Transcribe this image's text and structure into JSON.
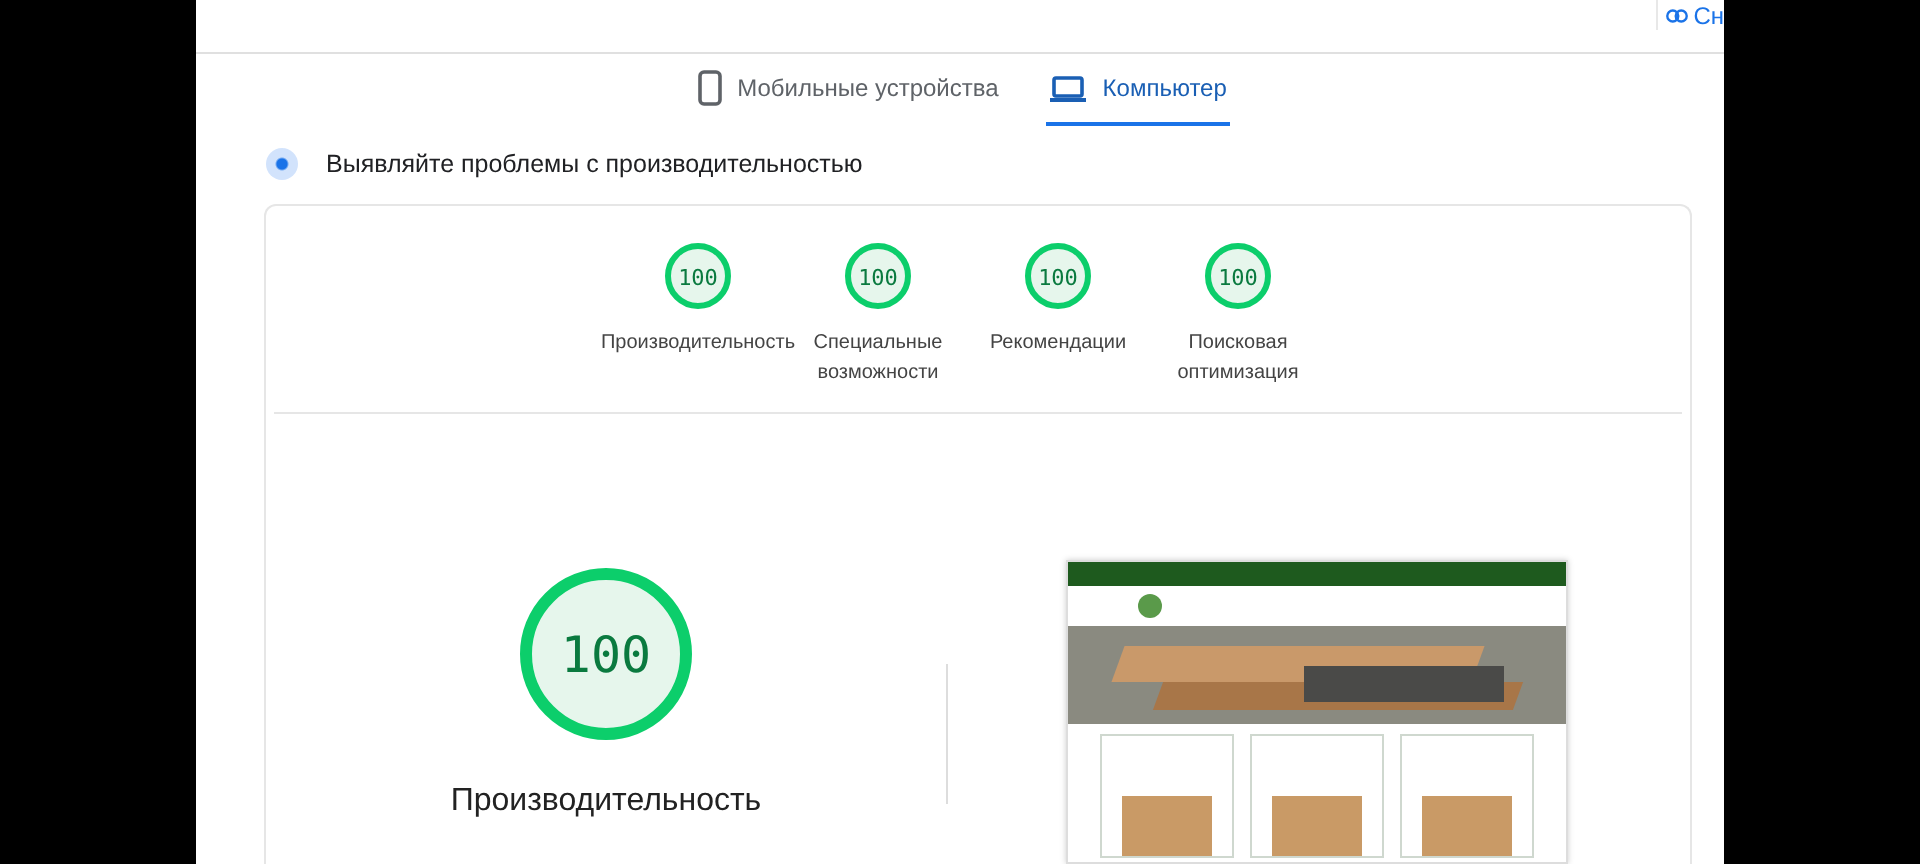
{
  "top_link": {
    "label": "Сн"
  },
  "tabs": [
    {
      "label": "Мобильные устройства",
      "kind": "phone",
      "selected": false
    },
    {
      "label": "Компьютер",
      "kind": "desktop",
      "selected": true
    }
  ],
  "heading": "Выявляйте проблемы с производительностью",
  "scores": [
    {
      "value": "100",
      "label": "Производительность"
    },
    {
      "value": "100",
      "label": "Специальные возможности"
    },
    {
      "value": "100",
      "label": "Рекомендации"
    },
    {
      "value": "100",
      "label": "Поисковая оптимизация"
    }
  ],
  "main_score": {
    "value": "100",
    "label": "Производительность"
  }
}
